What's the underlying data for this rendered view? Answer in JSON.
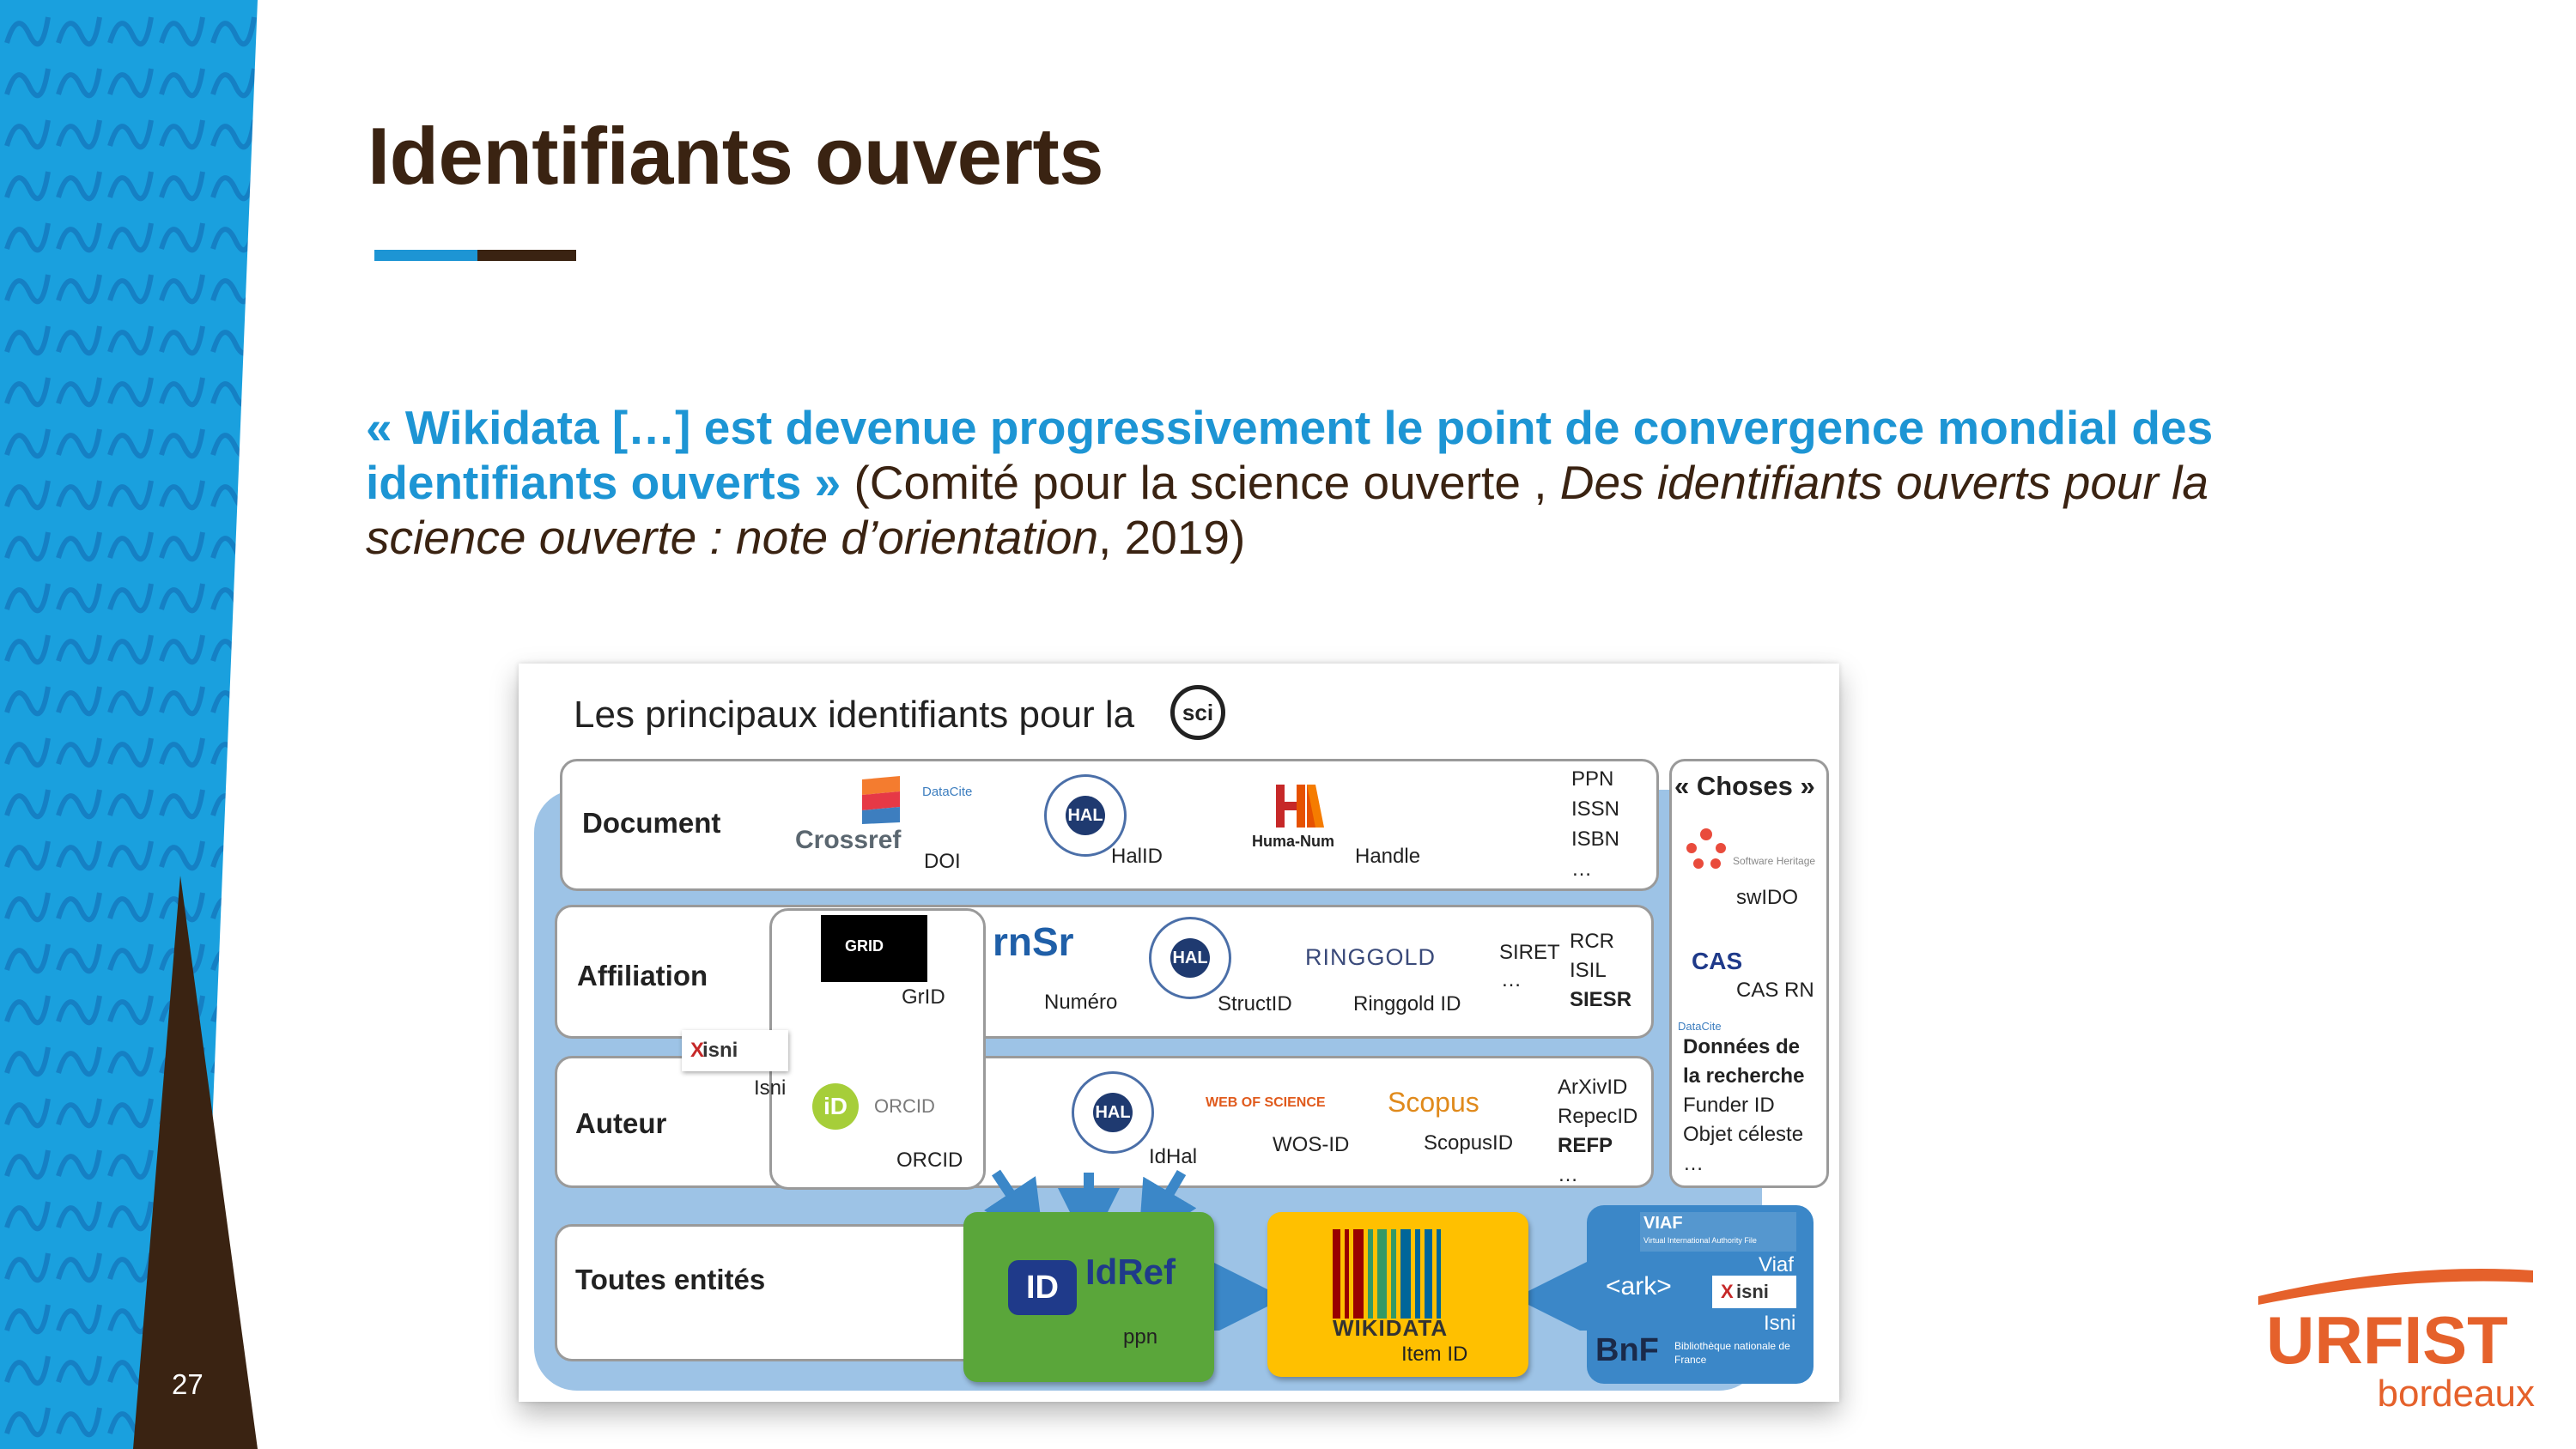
{
  "slide": {
    "title": "Identifiants ouverts",
    "quote_highlight": "« Wikidata […] est devenue progressivement le point de convergence mondial des identifiants ouverts »",
    "quote_plain_1": " (Comité pour la science ouverte , ",
    "quote_italic": "Des identifiants ouverts pour la science ouverte : note d’orientation",
    "quote_plain_2": ", 2019)",
    "slide_number": "27"
  },
  "logo": {
    "name": "URFIST",
    "subtitle": "bordeaux"
  },
  "figure": {
    "title": "Les principaux identifiants pour la",
    "badge": "sci",
    "rows": {
      "document": "Document",
      "affiliation": "Affiliation",
      "auteur": "Auteur",
      "toutes": "Toutes entités"
    },
    "document": {
      "crossref_logo": "Crossref",
      "datacite_logo": "DataCite",
      "doi": "DOI",
      "halid": "HalID",
      "huma_logo": "Huma-Num",
      "handle": "Handle",
      "list": [
        "PPN",
        "ISSN",
        "ISBN",
        "…"
      ]
    },
    "affiliation": {
      "grid_logo": "GRID",
      "grid": "GrID",
      "rnsr_logo": "rnSr",
      "numero": "Numéro",
      "structid": "StructID",
      "ringgold_logo": "RINGGOLD",
      "ringgold": "Ringgold ID",
      "siret": "SIRET",
      "ellipsis": "…",
      "list": [
        "RCR",
        "ISIL",
        "SIESR"
      ]
    },
    "auteur": {
      "isni_logo": "isni",
      "isni": "Isni",
      "orcid_logo": "ORCID",
      "orcid": "ORCID",
      "idhal": "IdHal",
      "wos_logo": "WEB OF SCIENCE",
      "wos": "WOS-ID",
      "scopus_logo": "Scopus",
      "scopus": "ScopusID",
      "list": [
        "ArXivID",
        "RepecID",
        "REFP",
        "…"
      ]
    },
    "hal_logo": "HAL",
    "choses": {
      "title": "« Choses »",
      "swh_logo": "Software Heritage",
      "swido": "swIDO",
      "cas_logo": "CAS",
      "casrn": "CAS RN",
      "datacite_logo": "DataCite",
      "donnees_1": "Données de",
      "donnees_2": "la recherche",
      "funder": "Funder ID",
      "objet": "Objet céleste",
      "ellipsis": "…"
    },
    "toutes": {
      "idref_logo": "IdRef",
      "ppn": "ppn",
      "wikidata_logo": "WIKIDATA",
      "itemid": "Item ID",
      "viaf_logo": "VIAF",
      "viaf_sub": "Virtual International Authority File",
      "viaf": "Viaf",
      "ark": "<ark>",
      "isni_logo": "isni",
      "isni": "Isni",
      "bnf_logo": "BnF",
      "bnf_sub": "Bibliothèque nationale de France"
    }
  },
  "colors": {
    "title_brown": "#3a2312",
    "accent_blue": "#1d95d4",
    "urfist_orange": "#e5612b",
    "flow_band": "#9dc3e6",
    "idref_green": "#5aa63a",
    "wikidata_yellow": "#ffc000",
    "bnf_blue": "#3b87c8"
  }
}
